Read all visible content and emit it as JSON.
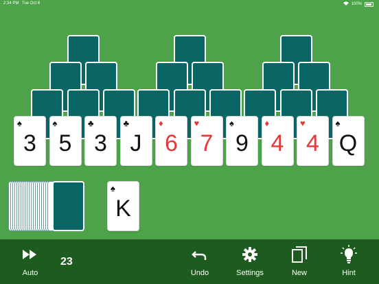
{
  "status": {
    "time": "2:34 PM",
    "date": "Tue Oct 8",
    "battery": "100%"
  },
  "pyramid": {
    "back_rows": 3,
    "face_row": [
      {
        "rank": "3",
        "suit": "♠",
        "color": "black"
      },
      {
        "rank": "5",
        "suit": "♠",
        "color": "black"
      },
      {
        "rank": "3",
        "suit": "♣",
        "color": "black"
      },
      {
        "rank": "J",
        "suit": "♣",
        "color": "black"
      },
      {
        "rank": "6",
        "suit": "♦",
        "color": "red"
      },
      {
        "rank": "7",
        "suit": "♥",
        "color": "red"
      },
      {
        "rank": "9",
        "suit": "♠",
        "color": "black"
      },
      {
        "rank": "4",
        "suit": "♦",
        "color": "red"
      },
      {
        "rank": "4",
        "suit": "♥",
        "color": "red"
      },
      {
        "rank": "Q",
        "suit": "♠",
        "color": "black"
      }
    ]
  },
  "waste": {
    "rank": "K",
    "suit": "♠",
    "color": "black"
  },
  "toolbar": {
    "auto_label": "Auto",
    "count": "23",
    "undo_label": "Undo",
    "settings_label": "Settings",
    "new_label": "New",
    "hint_label": "Hint"
  },
  "colors": {
    "felt": "#4da24a",
    "toolbar": "#1e5b1e",
    "card_back": "#0a6565"
  }
}
